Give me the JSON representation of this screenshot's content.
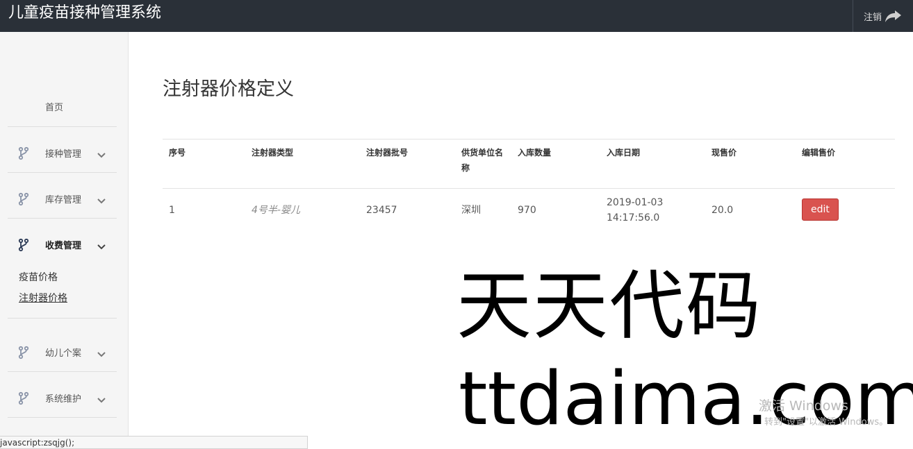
{
  "header": {
    "app_title": "儿童疫苗接种管理系统",
    "logout_label": "注销",
    "logout_icon": "share-arrow-icon"
  },
  "sidebar": {
    "home_label": "首页",
    "menus": [
      {
        "label": "接种管理",
        "icon": "branch-icon",
        "expanded": false
      },
      {
        "label": "库存管理",
        "icon": "branch-icon",
        "expanded": false
      },
      {
        "label": "收费管理",
        "icon": "branch-icon",
        "expanded": true
      },
      {
        "label": "幼儿个案",
        "icon": "branch-icon",
        "expanded": false
      },
      {
        "label": "系统维护",
        "icon": "branch-icon",
        "expanded": false
      }
    ],
    "sub_items": [
      {
        "label": "疫苗价格"
      },
      {
        "label": "注射器价格",
        "current": true
      }
    ]
  },
  "main": {
    "page_title": "注射器价格定义",
    "table": {
      "headers": [
        "序号",
        "注射器类型",
        "注射器批号",
        "供货单位名称",
        "入库数量",
        "入库日期",
        "现售价",
        "编辑售价"
      ],
      "rows": [
        {
          "index": "1",
          "type": "4号半-婴儿",
          "batch": "23457",
          "supplier": "深圳",
          "quantity": "970",
          "date_line1": "2019-01-03",
          "date_line2": "14:17:56.0",
          "price": "20.0",
          "action_label": "edit"
        }
      ]
    }
  },
  "watermark": {
    "cn": "天天代码",
    "url": "ttdaima.com"
  },
  "os_overlay": {
    "activate_title": "激活 Windows",
    "activate_hint": "转到\"设置\"以激活 Windows。"
  },
  "statusbar": {
    "text": "javascript:zsqjg();"
  },
  "colors": {
    "topbar_bg": "#2a3038",
    "sidebar_bg": "#f5f5f5",
    "danger_button": "#d9534f",
    "branch_icon": "#8a94a8"
  }
}
